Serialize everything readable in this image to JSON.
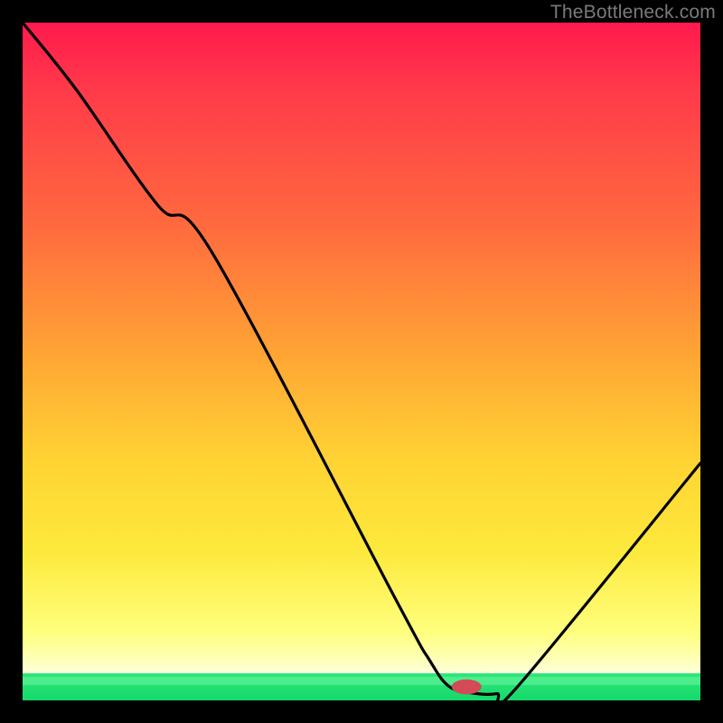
{
  "watermark": "TheBottleneck.com",
  "colors": {
    "background": "#000000",
    "gradient_top": "#ff1a4d",
    "gradient_mid": "#ffd433",
    "gradient_pale": "#fdffcf",
    "green": "#15d96b",
    "curve": "#000000",
    "marker": "#d44a57"
  },
  "chart_data": {
    "type": "line",
    "title": "",
    "xlabel": "",
    "ylabel": "",
    "xlim": [
      0,
      100
    ],
    "ylim": [
      0,
      100
    ],
    "series": [
      {
        "name": "bottleneck-curve",
        "x": [
          0,
          8,
          20,
          28,
          55,
          60,
          63,
          67,
          70,
          73,
          100
        ],
        "values": [
          100,
          90,
          73,
          66,
          15,
          6,
          2,
          1,
          1,
          2,
          35
        ]
      }
    ],
    "marker": {
      "name": "optimal-point",
      "x": 65.5,
      "y": 2,
      "rx_pct": 2.2,
      "ry_pct": 1.1
    },
    "grid": false,
    "legend": false
  }
}
